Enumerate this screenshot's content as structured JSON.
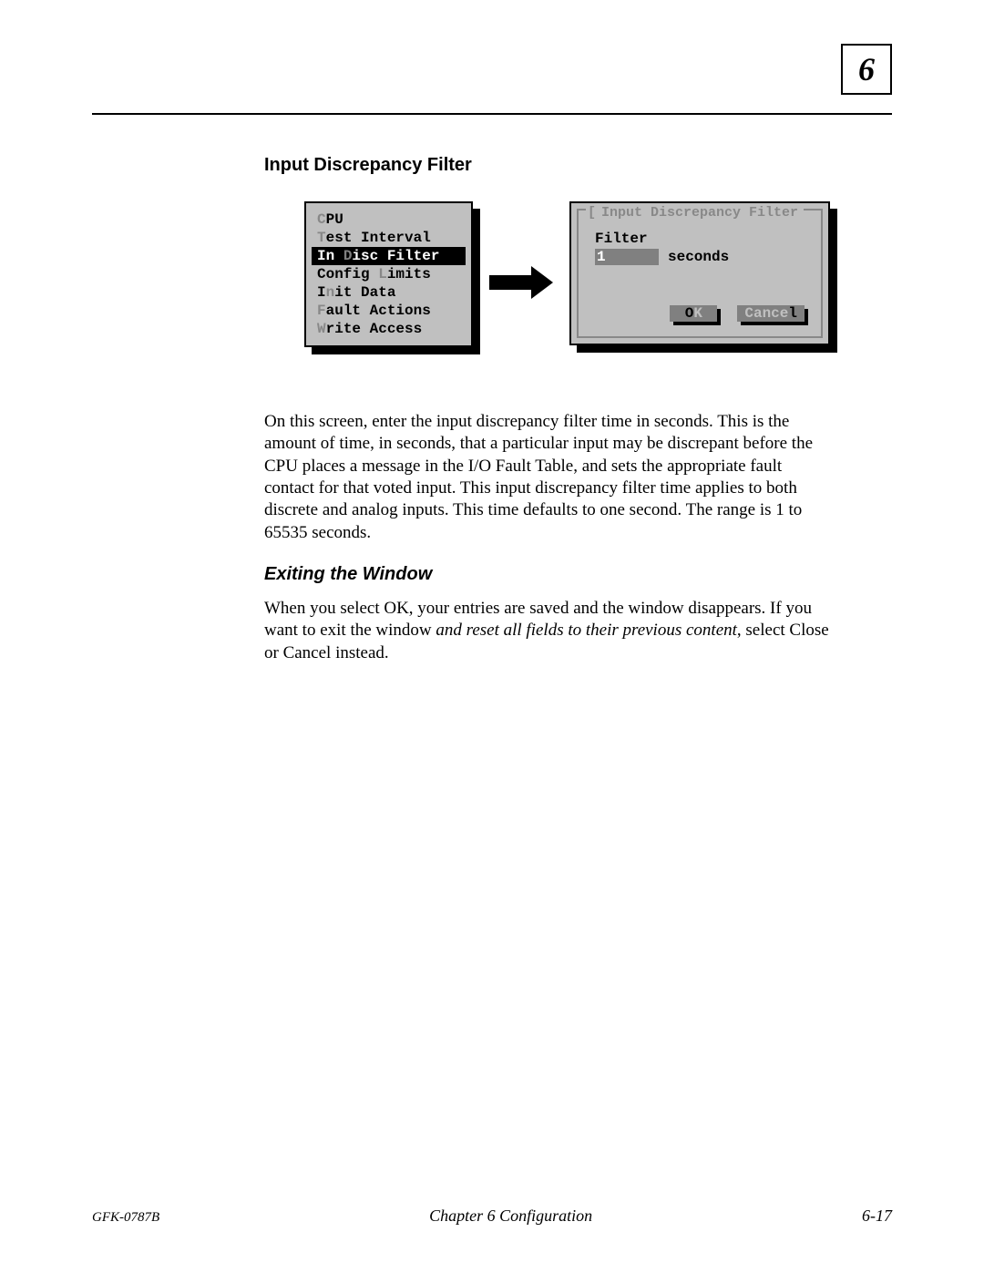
{
  "chapter_box_number": "6",
  "section_title": "Input Discrepancy Filter",
  "menu": {
    "items": [
      {
        "prefix": "C",
        "rest": "PU",
        "selected": false
      },
      {
        "prefix": "T",
        "rest": "est Interval",
        "selected": false
      },
      {
        "prefix": "D",
        "rest": "isc Filter",
        "leader": "In ",
        "selected": true
      },
      {
        "prefix": "L",
        "rest": "imits",
        "leader": "Config ",
        "selected": false
      },
      {
        "prefix": "n",
        "rest": "it Data",
        "leader": "I",
        "selected": false
      },
      {
        "prefix": "F",
        "rest": "ault Actions",
        "selected": false
      },
      {
        "prefix": "W",
        "rest": "rite Access",
        "selected": false
      }
    ]
  },
  "dialog": {
    "closebox": "[ ]",
    "title": "Input Discrepancy Filter",
    "filter_label": "Filter",
    "filter_value": "1",
    "seconds_label": "seconds",
    "ok_hotkey": "O",
    "ok_rest": "K",
    "cancel_label": "Cance",
    "cancel_hotkey": "l"
  },
  "body_paragraph": "On this screen, enter the input discrepancy filter time in seconds. This is the amount of time, in seconds, that a particular input may be discrepant before the CPU places a message in the I/O Fault Table, and sets the appropriate fault contact for that voted input. This input discrepancy filter time applies to both discrete and analog inputs. This time defaults to one second. The range is 1 to 65535 seconds.",
  "subheading": "Exiting the Window",
  "exit_paragraph_pre": "When you select OK, your entries are saved and the window disappears. If you want to exit the window ",
  "exit_paragraph_em": "and reset all fields to their previous content",
  "exit_paragraph_post": ", select Close or Cancel instead.",
  "footer": {
    "doc_id": "GFK-0787B",
    "chapter_line": "Chapter 6  Configuration",
    "page_number": "6-17"
  }
}
